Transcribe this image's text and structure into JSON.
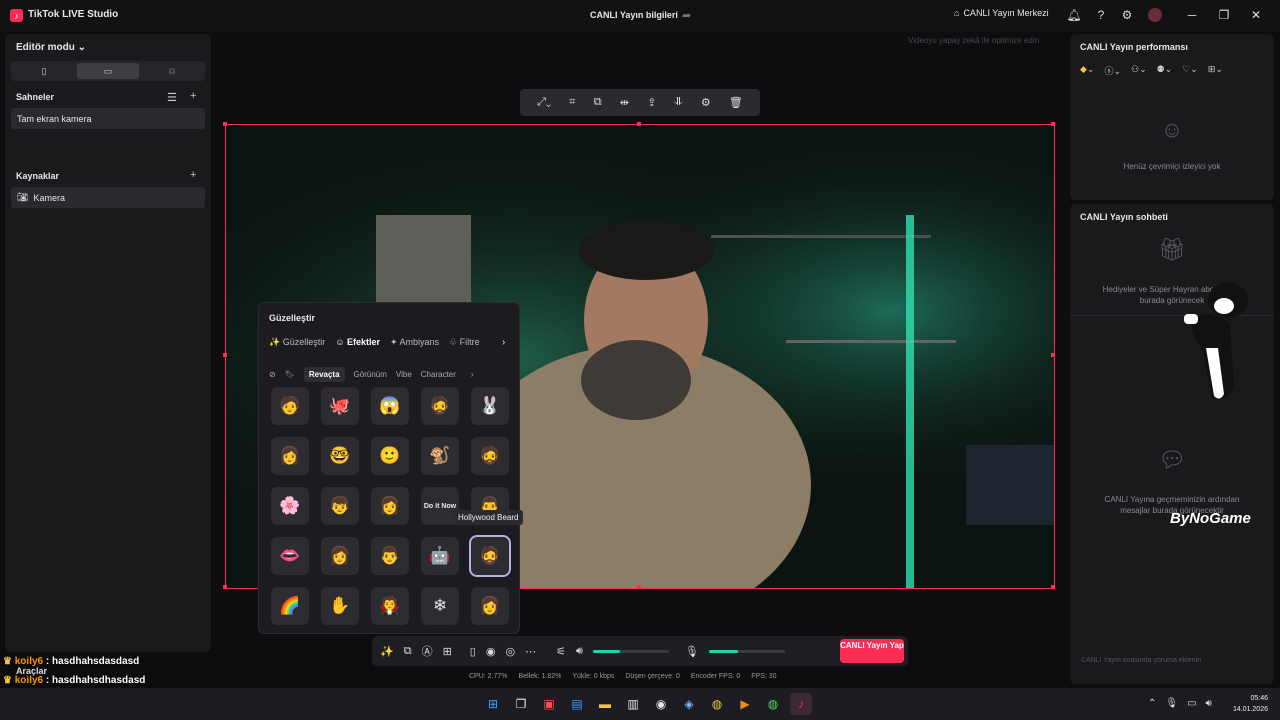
{
  "app": {
    "title": "TikTok LIVE Studio",
    "window_title": "CANLI Yayın bilgileri",
    "center_label": "CANLI Yayın Merkezi"
  },
  "left": {
    "editor_mode": "Editör modu",
    "scenes_title": "Sahneler",
    "scene_item": "Tam ekran kamera",
    "sources_title": "Kaynaklar",
    "source_item": "Kamera"
  },
  "canvas": {
    "hint": "Videoyu yapay zekâ ile optimize edin"
  },
  "beautify": {
    "title": "Güzelleştir",
    "tabs": [
      "Güzelleştir",
      "Efektler",
      "Ambiyans",
      "Filtre"
    ],
    "subtabs": [
      "Revaçta",
      "Görünüm",
      "Vibe",
      "Character"
    ],
    "tooltip": "Hollywood Beard",
    "grid": [
      "🧑",
      "🐙",
      "😱",
      "🧔",
      "🐰",
      "👩",
      "🤓",
      "🙂",
      "🐒",
      "🧔",
      "🌸",
      "👦",
      "👩",
      "Do It Now",
      "👨",
      "👄",
      "👩",
      "👨",
      "🤖",
      "🧔",
      "🌈",
      "✋",
      "🧛",
      "❄",
      "👩"
    ]
  },
  "bottom": {
    "go_live": "CANLI Yayın Yap",
    "volume_fraction": 0.36,
    "mic_fraction": 0.38
  },
  "stats": {
    "cpu": "CPU: 2.77%",
    "mem": "Bellek: 1.82%",
    "upload": "Yükle: 0 kbps",
    "dropped": "Düşen çerçeve: 0",
    "encoder": "Encoder FPS: 0",
    "fps": "FPS: 30"
  },
  "right": {
    "perf_title": "CANLI Yayın performansı",
    "perf_empty": "Henüz çevrimiçi izleyici yok",
    "chat_title": "CANLI Yayın sohbeti",
    "chat_empty1": "Hediyeler ve Süper Hayran abonelikleri burada görünecek",
    "chat_empty2": "CANLI Yayına geçmeminizin ardından mesajlar burada görünecektir",
    "chat_input": "CANLI Yayın sırasında yoruma eklenin"
  },
  "overlay": {
    "user": "koily6",
    "msg1": "hasdhahsdasdasd",
    "araclar": "Araçlar",
    "msg2": "hasdhahsdhasdasd",
    "watermark": "ByNoGame"
  },
  "taskbar": {
    "time": "05:46",
    "date": "14.01.2026"
  }
}
